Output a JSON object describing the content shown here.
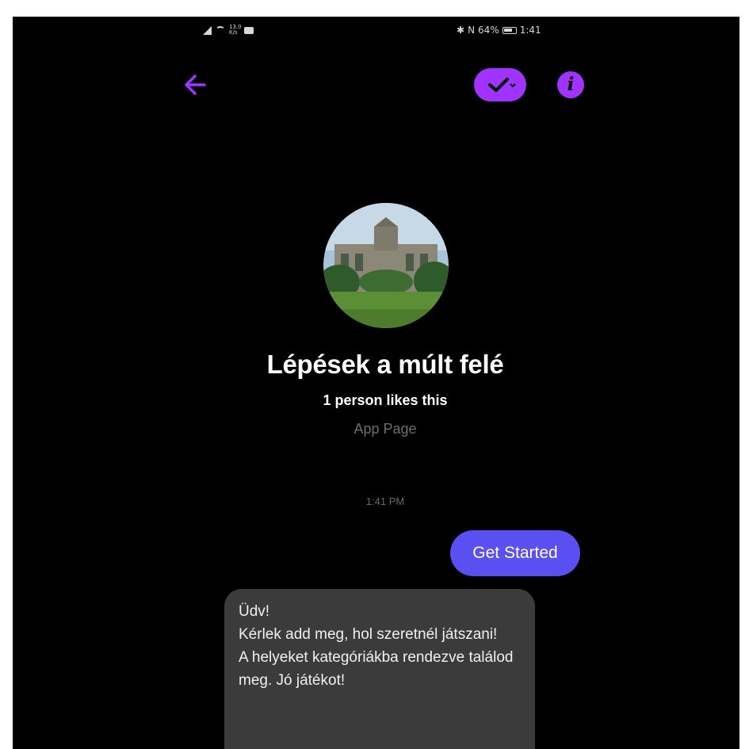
{
  "status_bar": {
    "speed": "13.0 K/s",
    "battery_percent": "64%",
    "time": "1:41"
  },
  "header": {
    "back_icon": "arrow-left-icon",
    "status_icon": "checkmark-pill-icon",
    "info_icon": "info-icon",
    "accent_color": "#a033ff"
  },
  "profile": {
    "name": "Lépések a múlt felé",
    "likes": "1 person likes this",
    "category": "App Page"
  },
  "conversation": {
    "timestamp": "1:41 PM",
    "messages": [
      {
        "direction": "sent",
        "text": "Get Started",
        "color": "#5a4ff0"
      },
      {
        "direction": "received",
        "text": "Üdv!\nKérlek add meg, hol szeretnél játszani!\nA helyeket kategóriákba rendezve találod meg. Jó játékot!",
        "color": "#3a3b3a"
      }
    ]
  }
}
